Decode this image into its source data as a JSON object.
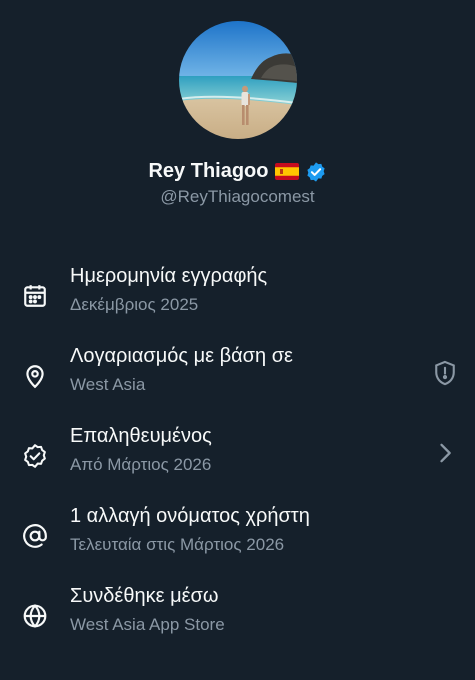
{
  "profile": {
    "display_name": "Rey Thiagoo",
    "handle": "@ReyThiagocomest",
    "flag_icon": "spain-flag-icon",
    "verified_icon": "verified-badge-icon",
    "verified_color": "#1d9bf0"
  },
  "details": [
    {
      "icon": "calendar-icon",
      "title": "Ημερομηνία εγγραφής",
      "subtitle": "Δεκέμβριος 2025"
    },
    {
      "icon": "location-pin-icon",
      "title": "Λογαριασμός με βάση σε",
      "subtitle": "West Asia",
      "trailing_icon": "shield-alert-icon"
    },
    {
      "icon": "verified-check-icon",
      "title": "Επαληθευμένος",
      "subtitle": "Από Μάρτιος 2026",
      "trailing_icon": "chevron-right-icon"
    },
    {
      "icon": "at-sign-icon",
      "title": "1 αλλαγή ονόματος χρήστη",
      "subtitle": "Τελευταία στις Μάρτιος 2026"
    },
    {
      "icon": "globe-icon",
      "title": "Συνδέθηκε μέσω",
      "subtitle": "West Asia App Store"
    }
  ],
  "colors": {
    "background": "#15202b",
    "primary_text": "#f7f9f9",
    "secondary_text": "#8b98a5",
    "accent": "#1d9bf0"
  }
}
